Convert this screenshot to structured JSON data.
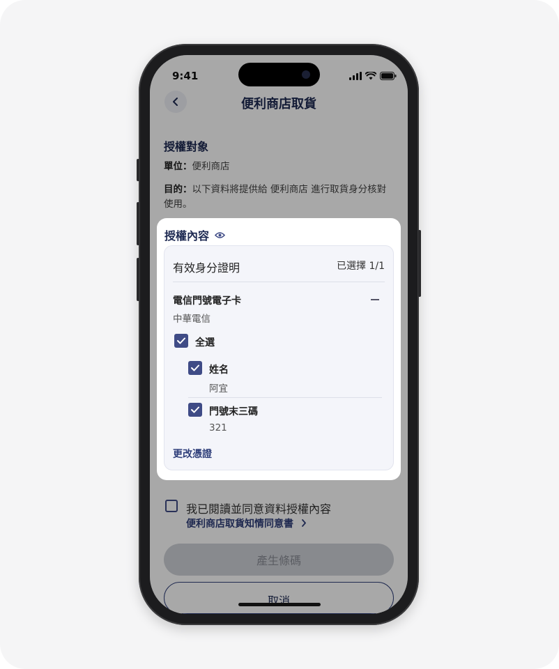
{
  "status_bar": {
    "time": "9:41"
  },
  "nav": {
    "title": "便利商店取貨"
  },
  "target": {
    "heading": "授權對象",
    "unit_label": "單位：",
    "unit_value": "便利商店",
    "purpose_label": "目的：",
    "purpose_value": "以下資料將提供給 便利商店 進行取貨身分核對使用。"
  },
  "auth": {
    "heading": "授權內容",
    "group_title": "有效身分證明",
    "selected_count": "已選擇 1/1",
    "credential_name": "電信門號電子卡",
    "credential_issuer": "中華電信",
    "select_all": "全選",
    "fields": [
      {
        "label": "姓名",
        "value": "阿宜"
      },
      {
        "label": "門號末三碼",
        "value": "321"
      }
    ],
    "change_link": "更改憑證"
  },
  "consent": {
    "text": "我已閱讀並同意資料授權內容",
    "link": "便利商店取貨知情同意書"
  },
  "buttons": {
    "primary": "產生條碼",
    "cancel": "取消"
  },
  "colors": {
    "brand": "#1e2a52",
    "checkbox": "#3f4b86",
    "link": "#2f3f7a"
  }
}
